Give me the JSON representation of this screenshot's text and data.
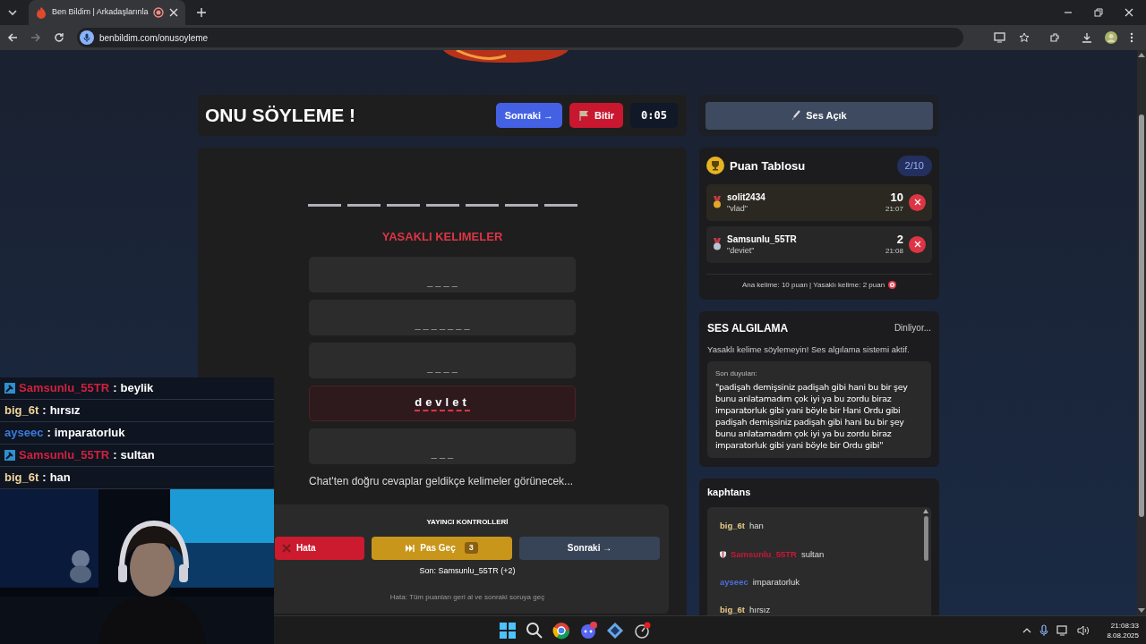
{
  "browser": {
    "tab_title": "Ben Bildim | Arkadaşlarınla",
    "recording": true,
    "url": "benbildim.com/onusoyleme"
  },
  "game": {
    "title": "ONU SÖYLEME !",
    "next_button": "Sonraki →",
    "finish_button": "Bitir",
    "timer": "0:05",
    "answer_slots": [
      {
        "revealed": false
      },
      {
        "revealed": false
      },
      {
        "revealed": false
      },
      {
        "revealed": false
      },
      {
        "revealed": false
      },
      {
        "revealed": false
      },
      {
        "revealed": false
      }
    ],
    "forbidden_title": "YASAKLI KELIMELER",
    "forbidden_words": [
      {
        "text": "_ _ _ _",
        "revealed": false
      },
      {
        "text": "_ _ _ _ _ _ _",
        "revealed": false
      },
      {
        "text": "_ _ _ _",
        "revealed": false
      },
      {
        "text": "devlet",
        "revealed": true
      },
      {
        "text": "_ _ _",
        "revealed": false
      }
    ],
    "hint": "Chat'ten doğru cevaplar geldikçe kelimeler görünecek...",
    "controls": {
      "title": "YAYINCI KONTROLLERİ",
      "buttons": [
        {
          "kind": "error",
          "label": "Hata"
        },
        {
          "kind": "pass",
          "label": "Pas Geç",
          "count": "3"
        },
        {
          "kind": "next",
          "label": "Sonraki →"
        }
      ],
      "last": "Son: Samsunlu_55TR (+2)",
      "help": "Hata: Tüm puanları geri al ve sonraki soruya geç"
    }
  },
  "sound_button": {
    "label": "Ses Açık",
    "on": true
  },
  "scoreboard": {
    "title": "Puan Tablosu",
    "round": "2/10",
    "entries": [
      {
        "kind": "gold",
        "name": "solit2434",
        "word": "\"vlad\"",
        "score": "10",
        "time": "21:07"
      },
      {
        "kind": "silver",
        "name": "Samsunlu_55TR",
        "word": "\"deviet\"",
        "score": "2",
        "time": "21:08"
      }
    ],
    "footer": "Ana kelime: 10 puan | Yasaklı kelime: 2 puan"
  },
  "detection": {
    "title": "SES ALGILAMA",
    "status": "Dinliyor...",
    "warning": "Yasaklı kelime söylemeyin! Ses algılama sistemi aktif.",
    "heard_label": "Son duyulan:",
    "heard_text": "\"padişah demişsiniz padişah gibi hani bu bir şey bunu anlatamadım çok iyi ya bu zordu biraz imparatorluk gibi yani böyle bir Hani Ordu gibi padişah demişsiniz padişah gibi hani bu bir şey bunu anlatamadım çok iyi ya bu zordu biraz imparatorluk gibi yani böyle bir Ordu gibi\""
  },
  "channel_chat": {
    "title": "kaphtans",
    "messages": [
      {
        "user": "big_6t",
        "message": "han",
        "color": "#e8c98a",
        "badge": false
      },
      {
        "user": "Samsunlu_55TR",
        "message": "sultan",
        "color": "#c8173a",
        "badge": true
      },
      {
        "user": "ayseec",
        "message": "imparatorluk",
        "color": "#4a6fd8",
        "badge": false
      },
      {
        "user": "big_6t",
        "message": "hırsız",
        "color": "#e8c98a",
        "badge": false
      }
    ]
  },
  "stream_chat": [
    {
      "user": "Samsunlu_55TR",
      "separator": ":",
      "message": "beylik",
      "color": "#d0213f",
      "badge": true
    },
    {
      "user": "big_6t",
      "separator": ":",
      "message": "hırsız",
      "color": "#f0d49a",
      "badge": false
    },
    {
      "user": "ayseec",
      "separator": ":",
      "message": "imparatorluk",
      "color": "#3b7bdc",
      "badge": false
    },
    {
      "user": "Samsunlu_55TR",
      "separator": ":",
      "message": "sultan",
      "color": "#d0213f",
      "badge": true
    },
    {
      "user": "big_6t",
      "separator": ":",
      "message": "han",
      "color": "#f0d49a",
      "badge": false
    }
  ],
  "taskbar": {
    "time": "21:08:33",
    "date": "8.08.2025"
  }
}
